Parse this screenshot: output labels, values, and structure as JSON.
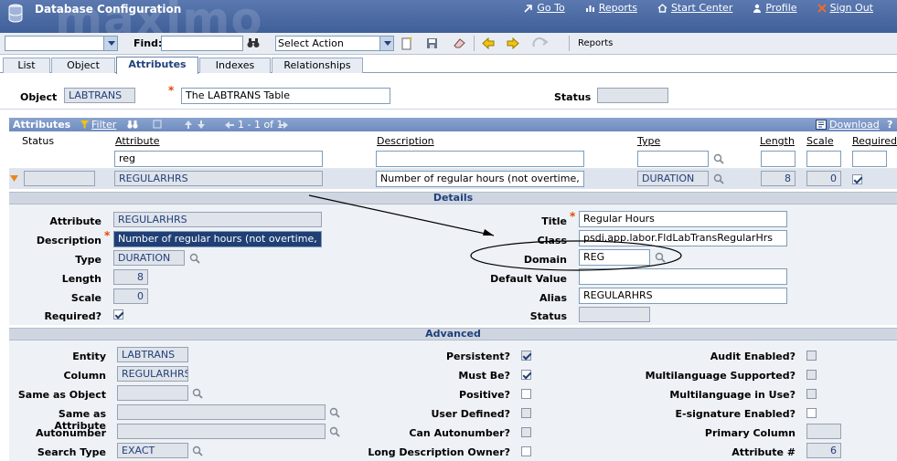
{
  "header": {
    "watermark": "maximo",
    "app_title": "Database Configuration",
    "links": [
      {
        "label": "Go To",
        "icon": "arrow-goto-icon"
      },
      {
        "label": "Reports",
        "icon": "reports-icon"
      },
      {
        "label": "Start Center",
        "icon": "home-icon"
      },
      {
        "label": "Profile",
        "icon": "profile-icon"
      },
      {
        "label": "Sign Out",
        "icon": "signout-icon"
      }
    ]
  },
  "toolbar": {
    "find_label": "Find:",
    "find_value": "",
    "select_action": "Select Action",
    "reports_label": "Reports"
  },
  "tabs": [
    {
      "label": "List",
      "active": false
    },
    {
      "label": "Object",
      "active": false
    },
    {
      "label": "Attributes",
      "active": true
    },
    {
      "label": "Indexes",
      "active": false
    },
    {
      "label": "Relationships",
      "active": false
    }
  ],
  "object": {
    "object_label": "Object",
    "object_value": "LABTRANS",
    "description_value": "The LABTRANS Table",
    "status_label": "Status",
    "status_value": ""
  },
  "attributes_table": {
    "title": "Attributes",
    "filter_label": "Filter",
    "pager": "1 - 1 of 1",
    "download_label": "Download",
    "help_label": "?",
    "columns": [
      "Status",
      "Attribute",
      "Description",
      "Type",
      "Length",
      "Scale",
      "Required?"
    ],
    "filter": {
      "attribute": "reg",
      "description": "",
      "type": "",
      "length": "",
      "scale": "",
      "required": ""
    },
    "row": {
      "status": "",
      "attribute": "REGULARHRS",
      "description": "Number of regular hours (not overtime, holiday",
      "type": "DURATION",
      "length": "8",
      "scale": "0",
      "required": true
    }
  },
  "details": {
    "title": "Details",
    "attribute_label": "Attribute",
    "attribute_value": "REGULARHRS",
    "description_label": "Description",
    "description_value": "Number of regular hours (not overtime, holiday",
    "type_label": "Type",
    "type_value": "DURATION",
    "length_label": "Length",
    "length_value": "8",
    "scale_label": "Scale",
    "scale_value": "0",
    "required_label": "Required?",
    "required_value": true,
    "title_label": "Title",
    "title_value": "Regular Hours",
    "class_label": "Class",
    "class_value": "psdi.app.labor.FldLabTransRegularHrs",
    "domain_label": "Domain",
    "domain_value": "REG",
    "default_label": "Default Value",
    "default_value": "",
    "alias_label": "Alias",
    "alias_value": "REGULARHRS",
    "status_label": "Status",
    "status_value": ""
  },
  "advanced": {
    "title": "Advanced",
    "entity_label": "Entity",
    "entity_value": "LABTRANS",
    "column_label": "Column",
    "column_value": "REGULARHRS",
    "same_obj_label": "Same as Object",
    "same_obj_value": "",
    "same_attr_label": "Same as Attribute",
    "same_attr_value": "",
    "autonumber_label": "Autonumber",
    "autonumber_value": "",
    "search_type_label": "Search Type",
    "search_type_value": "EXACT",
    "persistent_label": "Persistent?",
    "persistent": true,
    "must_be_label": "Must Be?",
    "must_be": true,
    "positive_label": "Positive?",
    "positive": false,
    "user_defined_label": "User Defined?",
    "user_defined": false,
    "can_autonumber_label": "Can Autonumber?",
    "can_autonumber": false,
    "long_desc_label": "Long Description Owner?",
    "long_desc": false,
    "audit_label": "Audit Enabled?",
    "audit": false,
    "ml_supported_label": "Multilanguage Supported?",
    "ml_supported": false,
    "ml_in_use_label": "Multilanguage in Use?",
    "ml_in_use": false,
    "esig_label": "E-signature Enabled?",
    "esig": false,
    "primary_col_label": "Primary Column",
    "primary_col_value": "",
    "attr_num_label": "Attribute #",
    "attr_num_value": "6"
  }
}
